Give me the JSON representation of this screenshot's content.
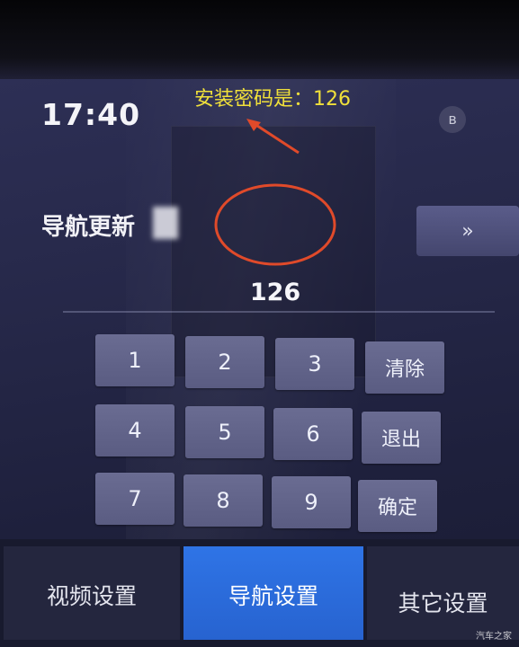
{
  "status": {
    "time": "17:40",
    "bluetooth_icon": "bluetooth-icon"
  },
  "annotation": {
    "hint": "安装密码是：126",
    "hint_color": "#f0e03a",
    "highlight_color": "#e04a2a"
  },
  "header": {
    "title": "导航更新",
    "dropdown_icon": "double-chevron-down-icon"
  },
  "password": {
    "value": "126"
  },
  "keypad": {
    "keys": [
      "1",
      "2",
      "3",
      "4",
      "5",
      "6",
      "7",
      "8",
      "9"
    ],
    "clear_label": "清除",
    "exit_label": "退出",
    "confirm_label": "确定"
  },
  "tabs": [
    {
      "label": "视频设置",
      "active": false
    },
    {
      "label": "导航设置",
      "active": true
    },
    {
      "label": "其它设置",
      "active": false
    }
  ],
  "colors": {
    "accent": "#2f74e6",
    "key_bg": "#5a5c82",
    "screen_bg": "#262849"
  },
  "watermark": "汽车之家"
}
